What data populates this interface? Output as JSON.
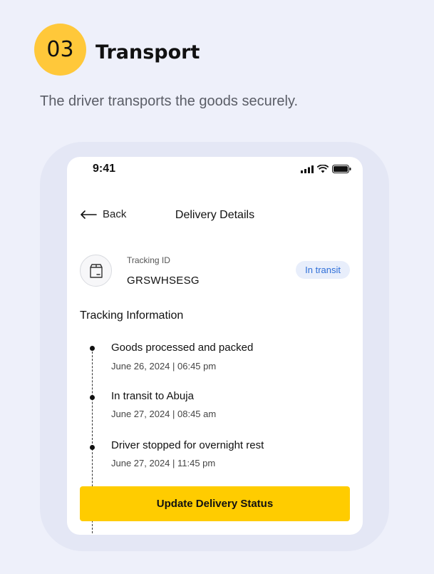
{
  "step": {
    "number": "03",
    "title": "Transport",
    "description": "The driver transports the goods securely."
  },
  "status_bar": {
    "time": "9:41"
  },
  "header": {
    "back_label": "Back",
    "title": "Delivery Details"
  },
  "package": {
    "tracking_label": "Tracking ID",
    "tracking_id": "GRSWHSESG",
    "status": "In transit"
  },
  "tracking": {
    "section_title": "Tracking Information",
    "events": [
      {
        "title": "Goods processed and packed",
        "date": "June 26, 2024 | 06:45 pm"
      },
      {
        "title": "In transit to Abuja",
        "date": "June 27, 2024 | 08:45 am"
      },
      {
        "title": "Driver stopped for overnight rest",
        "date": "June 27, 2024 | 11:45 pm"
      }
    ]
  },
  "actions": {
    "update_label": "Update Delivery Status"
  },
  "colors": {
    "accent": "#ffcc00",
    "badge_yellow": "#ffc83a",
    "status_blue": "#2f6fd8",
    "background": "#eef0fa"
  }
}
